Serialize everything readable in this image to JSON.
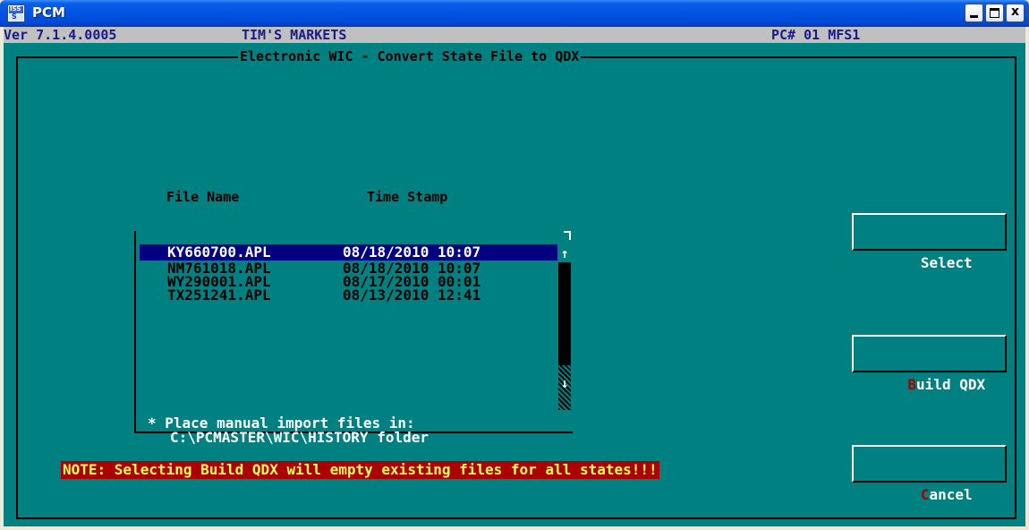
{
  "window": {
    "title": "PCM",
    "icon": "iss-app-icon",
    "icon_text_top": "ISS",
    "icon_text_bottom": "S",
    "controls": [
      "minimize-icon",
      "maximize-icon",
      "close-icon"
    ],
    "close_glyph": "x"
  },
  "header": {
    "version": "Ver 7.1.4.0005",
    "store": "TIM'S MARKETS",
    "pc": "PC# 01 MFS1"
  },
  "screen": {
    "title": "Electronic WIC - Convert State File to QDX"
  },
  "file_list": {
    "columns": [
      "File Name",
      "Time Stamp"
    ],
    "rows": [
      {
        "file": "KY660700.APL",
        "timestamp": "08/18/2010 10:07",
        "selected": true
      },
      {
        "file": "NM761018.APL",
        "timestamp": "08/18/2010 10:07",
        "selected": false
      },
      {
        "file": "WY290001.APL",
        "timestamp": "08/17/2010 00:01",
        "selected": false
      },
      {
        "file": "TX251241.APL",
        "timestamp": "08/13/2010 12:41",
        "selected": false
      }
    ],
    "scroll_up_glyph": "↑",
    "scroll_down_glyph": "↓"
  },
  "note": {
    "line1": "* Place manual import files in:",
    "line2": "C:\\PCMASTER\\WIC\\HISTORY folder"
  },
  "buttons": {
    "select": {
      "label": "Select"
    },
    "build": {
      "hotkey": "B",
      "rest": "uild QDX"
    },
    "cancel": {
      "hotkey": "C",
      "rest": "ancel"
    }
  },
  "warning": "NOTE: Selecting Build QDX will empty existing files for all states!!!",
  "colors": {
    "console_bg": "#008080",
    "selection_bg": "#000080",
    "warning_bg": "#AA0000",
    "warning_fg": "#FFFF55",
    "hotkey": "#AA0000"
  }
}
